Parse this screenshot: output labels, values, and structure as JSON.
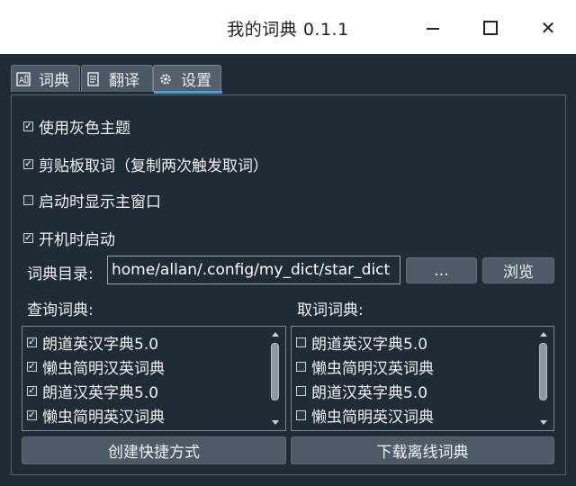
{
  "window": {
    "title": "我的词典 0.1.1"
  },
  "tabs": [
    {
      "label": "词典",
      "icon": "dictionary-icon"
    },
    {
      "label": "翻译",
      "icon": "translate-icon"
    },
    {
      "label": "设置",
      "icon": "gear-icon",
      "active": true
    }
  ],
  "settings": {
    "options": [
      {
        "label": "使用灰色主题",
        "checked": true
      },
      {
        "label": "剪贴板取词（复制两次触发取词）",
        "checked": true
      },
      {
        "label": "启动时显示主窗口",
        "checked": false
      },
      {
        "label": "开机时启动",
        "checked": true
      }
    ],
    "dict_dir": {
      "label": "词典目录:",
      "value": "home/allan/.config/my_dict/star_dict"
    },
    "dots_button": "...",
    "browse_button": "浏览",
    "query_dicts": {
      "label": "查询词典:",
      "items": [
        {
          "name": "朗道英汉字典5.0",
          "checked": true
        },
        {
          "name": "懒虫简明汉英词典",
          "checked": true
        },
        {
          "name": "朗道汉英字典5.0",
          "checked": true
        },
        {
          "name": "懒虫简明英汉词典",
          "checked": true
        }
      ]
    },
    "pick_dicts": {
      "label": "取词词典:",
      "items": [
        {
          "name": "朗道英汉字典5.0",
          "checked": false
        },
        {
          "name": "懒虫简明汉英词典",
          "checked": false
        },
        {
          "name": "朗道汉英字典5.0",
          "checked": false
        },
        {
          "name": "懒虫简明英汉词典",
          "checked": false
        }
      ]
    },
    "create_shortcut_button": "创建快捷方式",
    "download_button": "下载离线词典"
  },
  "colors": {
    "background": "#1f2b36",
    "button": "#4d5b69",
    "accent": "#3fa0e6"
  }
}
